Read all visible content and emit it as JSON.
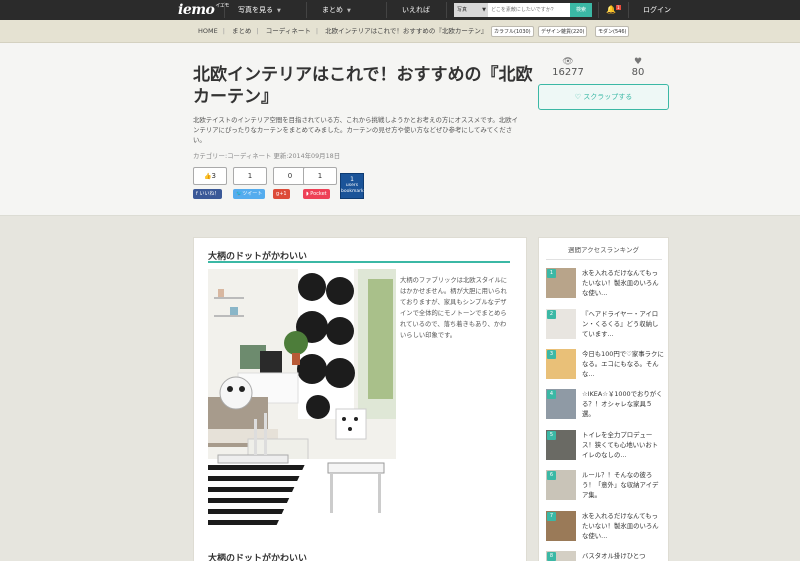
{
  "header": {
    "logo": "iemo",
    "logo_sub": "イエモ",
    "nav": [
      "写真を見る",
      "まとめ",
      "いえれば"
    ],
    "search_category": "写真",
    "search_placeholder": "どこを素敵にしたいですか?",
    "search_button": "検索",
    "notification_count": "1",
    "login": "ログイン"
  },
  "breadcrumb": [
    "HOME",
    "まとめ",
    "コーディネート",
    "北欧インテリアはこれで！おすすめの『北欧カーテン』"
  ],
  "tags": [
    "カラフル(1030)",
    "デザイン雑貨(220)",
    "モダン(546)"
  ],
  "article": {
    "title": "北欧インテリアはこれで！おすすめの『北欧カーテン』",
    "description": "北欧テイストのインテリア空間を目指されている方、これから挑戦しようかとお考えの方にオススメです。北欧インテリアにぴったりなカーテンをまとめてみました。カーテンの見せ方や使い方などぜひ参考にしてみてください。",
    "category": "カテゴリー:コーディネート",
    "updated": "更新:2014年09月18日",
    "views": "16277",
    "likes": "80",
    "scrap_button": "スクラップする"
  },
  "share": {
    "counts": [
      "3",
      "1",
      "0",
      "1"
    ],
    "buttons": [
      "いいね！",
      "ツイート",
      "+1",
      "Pocket"
    ],
    "hatena_count": "1",
    "hatena_label1": "users",
    "hatena_label2": "bookmark"
  },
  "section": {
    "title": "大柄のドットがかわいい",
    "text": "大柄のファブリックは北欧スタイルにはかかせません。柄が大胆に用いられておりますが、家具もシンプルなデザインで全体的にモノトーンでまとめられているので、落ち着きもあり、かわいらしい印象です。",
    "next_title": "大柄のドットがかわいい"
  },
  "ranking": {
    "title": "週間アクセスランキング",
    "items": [
      {
        "rank": "1",
        "text": "水を入れるだけなんてもったいない！製氷皿のいろんな使い..."
      },
      {
        "rank": "2",
        "text": "『ヘアドライヤー・アイロン・くるくる』どう収納しています..."
      },
      {
        "rank": "3",
        "text": "今日も100円で♡家事ラクになる。エコにもなる。そんな..."
      },
      {
        "rank": "4",
        "text": "☆IKEA☆￥1000でおりがくる？！オシャレな家具５選。"
      },
      {
        "rank": "5",
        "text": "トイレを全力プロデュース！狭くても心地いいおトイレのなしの..."
      },
      {
        "rank": "6",
        "text": "ルール？！そんなの彼ろう！「意外」な収納アイデア集。"
      },
      {
        "rank": "7",
        "text": "水を入れるだけなんてもったいない！製氷皿のいろんな使い..."
      },
      {
        "rank": "8",
        "text": "バスタオル掛けひとつ"
      }
    ]
  },
  "colors": {
    "accent": "#3bb8a5",
    "topbar": "#2b2b2b",
    "facebook": "#3b5998",
    "twitter": "#55acee",
    "google": "#dd4b39",
    "pocket": "#ee4056",
    "hatena": "#1b5499"
  }
}
